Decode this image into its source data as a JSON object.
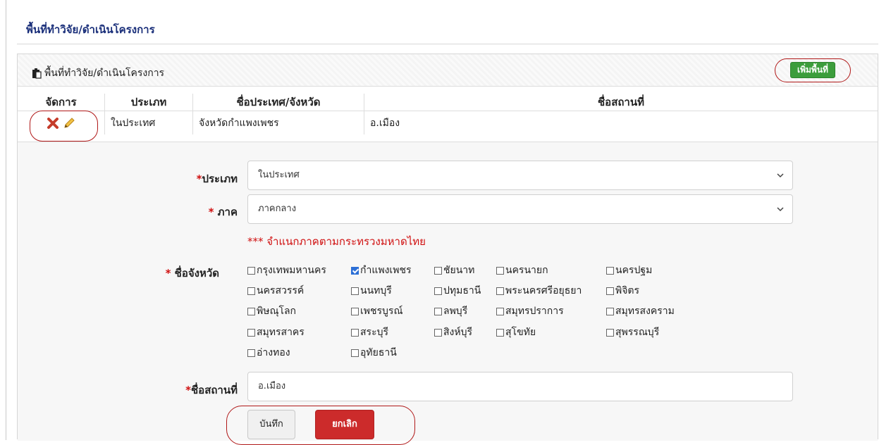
{
  "page": {
    "title": "พื้นที่ทำวิจัย/ดำเนินโครงการ"
  },
  "panel": {
    "title": "พื้นที่ทำวิจัย/ดำเนินโครงการ",
    "add_button": "เพิ่มพื้นที่"
  },
  "table": {
    "headers": [
      "จัดการ",
      "ประเภท",
      "ชื่อประเทศ/จังหวัด",
      "ชื่อสถานที่"
    ],
    "rows": [
      {
        "type": "ในประเทศ",
        "province": "จังหวัดกำแพงเพชร",
        "place": "อ.เมือง"
      }
    ]
  },
  "form": {
    "type_label": "ประเภท",
    "type_value": "ในประเทศ",
    "region_label": " ภาค",
    "region_value": "ภาคกลาง",
    "region_note": "*** จำแนกภาคตามกระทรวงมหาดไทย",
    "province_label": " ชื่อจังหวัด",
    "provinces": [
      {
        "name": "กรุงเทพมหานคร",
        "checked": false
      },
      {
        "name": "กำแพงเพชร",
        "checked": true
      },
      {
        "name": "ชัยนาท",
        "checked": false
      },
      {
        "name": "นครนายก",
        "checked": false
      },
      {
        "name": "นครปฐม",
        "checked": false
      },
      {
        "name": "นครสวรรค์",
        "checked": false
      },
      {
        "name": "นนทบุรี",
        "checked": false
      },
      {
        "name": "ปทุมธานี",
        "checked": false
      },
      {
        "name": "พระนครศรีอยุธยา",
        "checked": false
      },
      {
        "name": "พิจิตร",
        "checked": false
      },
      {
        "name": "พิษณุโลก",
        "checked": false
      },
      {
        "name": "เพชรบูรณ์",
        "checked": false
      },
      {
        "name": "ลพบุรี",
        "checked": false
      },
      {
        "name": "สมุทรปราการ",
        "checked": false
      },
      {
        "name": "สมุทรสงคราม",
        "checked": false
      },
      {
        "name": "สมุทรสาคร",
        "checked": false
      },
      {
        "name": "สระบุรี",
        "checked": false
      },
      {
        "name": "สิงห์บุรี",
        "checked": false
      },
      {
        "name": "สุโขทัย",
        "checked": false
      },
      {
        "name": "สุพรรณบุรี",
        "checked": false
      },
      {
        "name": "อ่างทอง",
        "checked": false
      },
      {
        "name": "อุทัยธานี",
        "checked": false
      }
    ],
    "place_label": "ชื่อสถานที่",
    "place_value": "อ.เมือง",
    "save_button": "บันทึก",
    "cancel_button": "ยกเลิก"
  },
  "colors": {
    "accent_green": "#3c9d3c",
    "cancel_red": "#cc2b2b",
    "annotation_red": "#b01818",
    "title_blue": "#1a2f7a"
  }
}
